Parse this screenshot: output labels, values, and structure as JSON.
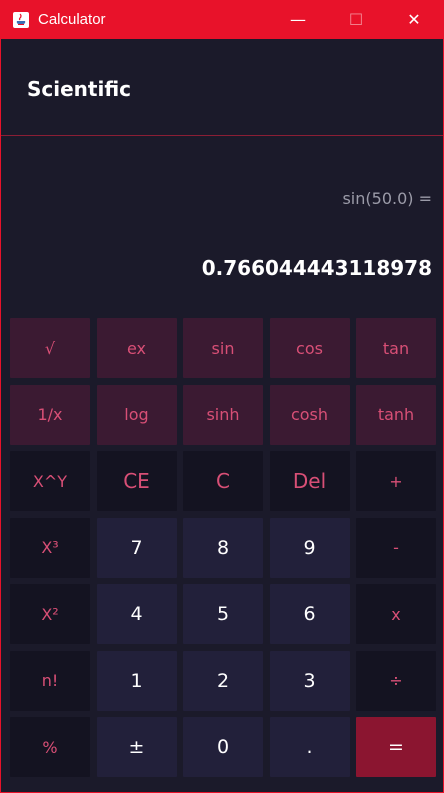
{
  "window": {
    "title": "Calculator",
    "controls": {
      "minimize": "—",
      "maximize": "☐",
      "close": "✕"
    }
  },
  "header": {
    "mode": "Scientific"
  },
  "display": {
    "expression": "sin(50.0) =",
    "result": "0.766044443118978"
  },
  "keys": [
    {
      "label": "√",
      "kind": "sci"
    },
    {
      "label": "ex",
      "kind": "sci"
    },
    {
      "label": "sin",
      "kind": "sci"
    },
    {
      "label": "cos",
      "kind": "sci"
    },
    {
      "label": "tan",
      "kind": "sci"
    },
    {
      "label": "1/x",
      "kind": "sci"
    },
    {
      "label": "log",
      "kind": "sci"
    },
    {
      "label": "sinh",
      "kind": "sci"
    },
    {
      "label": "cosh",
      "kind": "sci"
    },
    {
      "label": "tanh",
      "kind": "sci"
    },
    {
      "label": "X^Y",
      "kind": "op"
    },
    {
      "label": "CE",
      "kind": "clr"
    },
    {
      "label": "C",
      "kind": "clr"
    },
    {
      "label": "Del",
      "kind": "clr"
    },
    {
      "label": "+",
      "kind": "op"
    },
    {
      "label": "X³",
      "kind": "op"
    },
    {
      "label": "7",
      "kind": "num"
    },
    {
      "label": "8",
      "kind": "num"
    },
    {
      "label": "9",
      "kind": "num"
    },
    {
      "label": "-",
      "kind": "op"
    },
    {
      "label": "X²",
      "kind": "op"
    },
    {
      "label": "4",
      "kind": "num"
    },
    {
      "label": "5",
      "kind": "num"
    },
    {
      "label": "6",
      "kind": "num"
    },
    {
      "label": "x",
      "kind": "op"
    },
    {
      "label": "n!",
      "kind": "op"
    },
    {
      "label": "1",
      "kind": "num"
    },
    {
      "label": "2",
      "kind": "num"
    },
    {
      "label": "3",
      "kind": "num"
    },
    {
      "label": "÷",
      "kind": "op"
    },
    {
      "label": "%",
      "kind": "op"
    },
    {
      "label": "±",
      "kind": "num"
    },
    {
      "label": "0",
      "kind": "num"
    },
    {
      "label": ".",
      "kind": "num"
    },
    {
      "label": "=",
      "kind": "eq"
    }
  ],
  "colors": {
    "titlebar": "#e8122a",
    "background": "#1b1a2a",
    "accent_text": "#d84f76",
    "equals": "#8b1530"
  }
}
